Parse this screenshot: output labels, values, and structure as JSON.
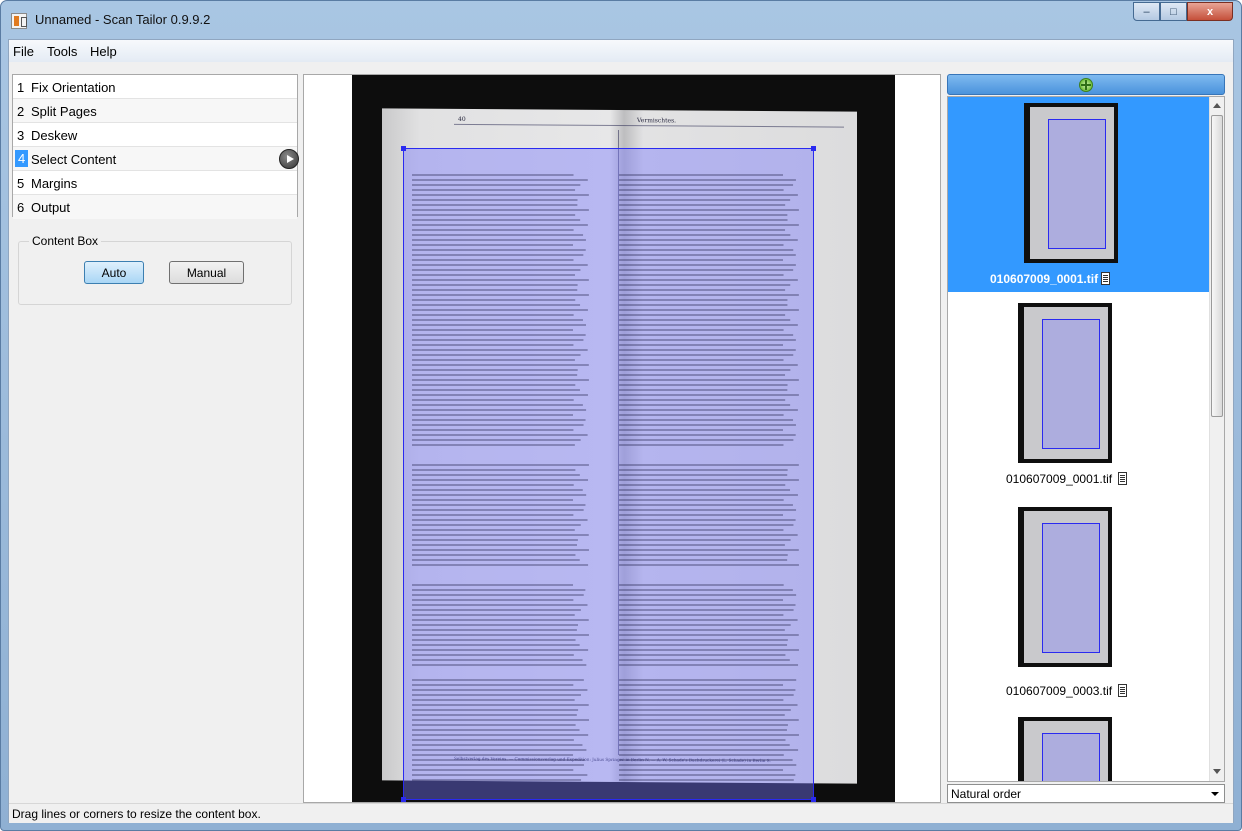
{
  "window": {
    "title": "Unnamed - Scan Tailor 0.9.9.2",
    "min": "–",
    "max": "□",
    "close": "x"
  },
  "menu": [
    "File",
    "Tools",
    "Help"
  ],
  "stages": [
    {
      "num": "1",
      "label": "Fix Orientation"
    },
    {
      "num": "2",
      "label": "Split Pages"
    },
    {
      "num": "3",
      "label": "Deskew"
    },
    {
      "num": "4",
      "label": "Select Content",
      "selected": true
    },
    {
      "num": "5",
      "label": "Margins"
    },
    {
      "num": "6",
      "label": "Output"
    }
  ],
  "content_box": {
    "title": "Content Box",
    "auto": "Auto",
    "manual": "Manual",
    "active": "Auto"
  },
  "page_preview": {
    "left_header": "40",
    "center_header": "Vermischtes.",
    "footer": "Selbstverlag des Vereins. — Commissionsverlag und Expedition: Julius Springer in Berlin N. — A. W. Schade's Buchdruckerei (L. Schade) in Berlin S."
  },
  "thumbnails": [
    {
      "label": "010607009_0001.tif",
      "selected": true
    },
    {
      "label": "010607009_0001.tif",
      "selected": false
    },
    {
      "label": "010607009_0003.tif",
      "selected": false
    },
    {
      "label": "",
      "selected": false
    }
  ],
  "sort_order": {
    "selected": "Natural order"
  },
  "status": "Drag lines or corners to resize the content box.",
  "colors": {
    "accent": "#3399ff",
    "content_box": "#2a2af0",
    "title_bar": "#a9c6e3"
  }
}
